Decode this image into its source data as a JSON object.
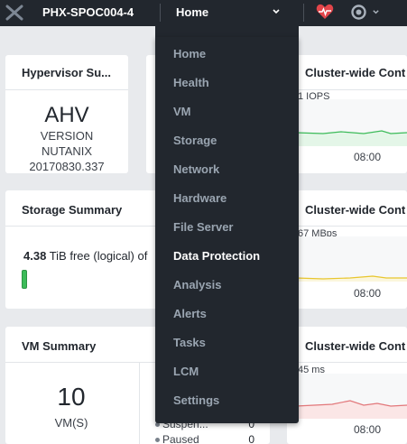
{
  "header": {
    "cluster_name": "PHX-SPOC004-4",
    "current_view": "Home"
  },
  "nav_menu": [
    {
      "label": "Home"
    },
    {
      "label": "Health"
    },
    {
      "label": "VM"
    },
    {
      "label": "Storage"
    },
    {
      "label": "Network"
    },
    {
      "label": "Hardware"
    },
    {
      "label": "File Server"
    },
    {
      "label": "Data Protection",
      "highlighted": true
    },
    {
      "label": "Analysis"
    },
    {
      "label": "Alerts"
    },
    {
      "label": "Tasks"
    },
    {
      "label": "LCM"
    },
    {
      "label": "Settings"
    }
  ],
  "hypervisor": {
    "title": "Hypervisor Su...",
    "name": "AHV",
    "version_label": "VERSION",
    "vendor": "NUTANIX",
    "version": "20170830.337"
  },
  "storage": {
    "title": "Storage Summary",
    "free_value": "4.38",
    "free_unit": "TiB",
    "free_label": "free (logical) of"
  },
  "vm_summary": {
    "title": "VM Summary",
    "count": "10",
    "unit": "VM(S)",
    "states": [
      {
        "label": "Suspen...",
        "value": "0"
      },
      {
        "label": "Paused",
        "value": "0"
      }
    ]
  },
  "cluster_charts": [
    {
      "title": "Cluster-wide Cont",
      "metric": "1 IOPS",
      "time": "08:00",
      "color": "#3cbb59",
      "fill": "#e4f6e8"
    },
    {
      "title": "Cluster-wide Cont",
      "metric": "67 MBps",
      "time": "08:00",
      "color": "#e8c62f",
      "fill": "#fbf6dc"
    },
    {
      "title": "Cluster-wide Cont",
      "metric": "45 ms",
      "time": "08:00",
      "color": "#e2777a",
      "fill": "#fbe6e6"
    }
  ],
  "colors": {
    "topbar": "#22272e",
    "accent_health": "#e2454a"
  }
}
